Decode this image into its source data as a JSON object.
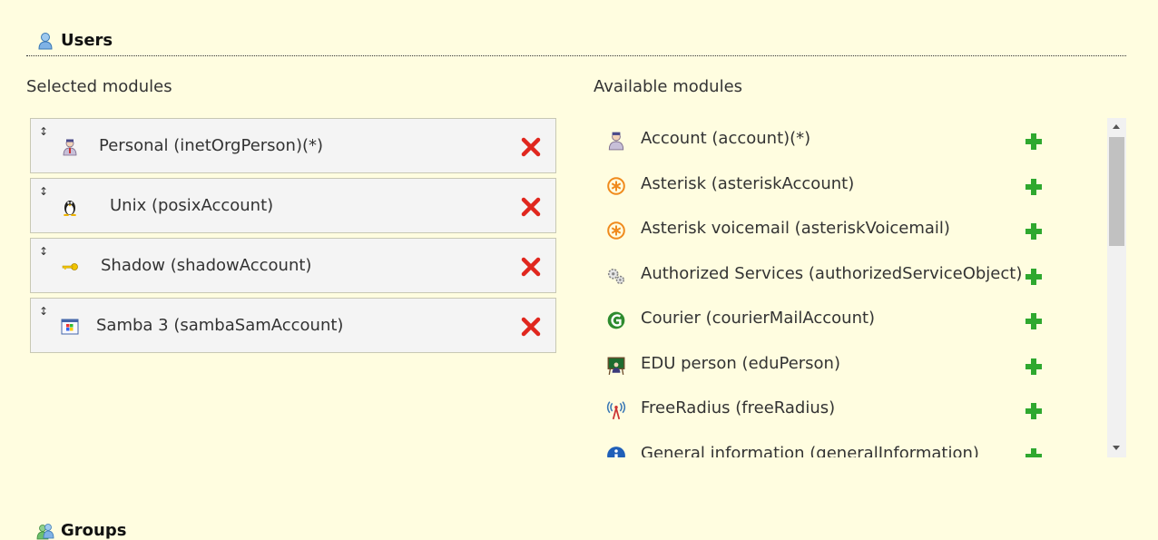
{
  "users": {
    "title": "Users",
    "icon": "user-icon",
    "selected_label": "Selected modules",
    "available_label": "Available modules",
    "selected": [
      {
        "label": "Personal (inetOrgPerson)(*)",
        "icon": "personal-icon"
      },
      {
        "label": "Unix (posixAccount)",
        "icon": "tux-penguin-icon"
      },
      {
        "label": "Shadow (shadowAccount)",
        "icon": "key-icon"
      },
      {
        "label": "Samba 3 (sambaSamAccount)",
        "icon": "samba-windows-icon"
      }
    ],
    "available": [
      {
        "label": "Account (account)(*)",
        "icon": "account-user-icon"
      },
      {
        "label": "Asterisk (asteriskAccount)",
        "icon": "asterisk-icon"
      },
      {
        "label": "Asterisk voicemail (asteriskVoicemail)",
        "icon": "asterisk-icon"
      },
      {
        "label": "Authorized Services (authorizedServiceObject)",
        "icon": "services-gears-icon"
      },
      {
        "label": "Courier (courierMailAccount)",
        "icon": "courier-icon"
      },
      {
        "label": "EDU person (eduPerson)",
        "icon": "edu-person-icon"
      },
      {
        "label": "FreeRadius (freeRadius)",
        "icon": "radio-antenna-icon"
      },
      {
        "label": "General information (generalInformation)",
        "icon": "info-icon"
      }
    ]
  },
  "groups": {
    "title": "Groups",
    "icon": "group-icon"
  },
  "colors": {
    "background": "#fffde0",
    "remove": "#e0271e",
    "add": "#2fa82f"
  }
}
